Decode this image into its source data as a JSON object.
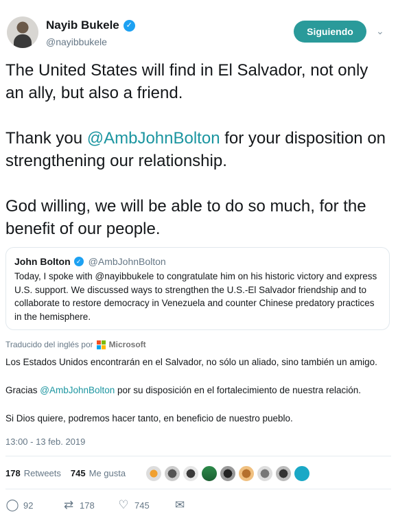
{
  "author": {
    "name": "Nayib Bukele",
    "handle": "@nayibbukele",
    "follow_label": "Siguiendo"
  },
  "tweet": {
    "paragraphs": [
      {
        "text": "The United States will find in El Salvador, not only an ally, but also a friend."
      },
      {
        "pre": "Thank you ",
        "mention": "@AmbJohnBolton",
        "post": " for your disposition on strengthening our relationship."
      },
      {
        "text": "God willing, we will be able to do so much, for the benefit of our people."
      }
    ]
  },
  "quote": {
    "name": "John Bolton",
    "handle": "@AmbJohnBolton",
    "text": "Today, I spoke with @nayibbukele to congratulate him on his historic victory and express U.S. support. We discussed ways to strengthen the U.S.-El Salvador friendship and to collaborate to restore democracy in Venezuela and counter Chinese predatory practices in the hemisphere."
  },
  "translation": {
    "label": "Traducido del inglés por",
    "provider": "Microsoft",
    "p1": "Los Estados Unidos encontrarán en el Salvador, no sólo un aliado, sino también un amigo.",
    "p2_pre": "Gracias ",
    "p2_mention": "@AmbJohnBolton",
    "p2_post": " por su disposición en el fortalecimiento de nuestra relación.",
    "p3": "Si Dios quiere, podremos hacer tanto, en beneficio de nuestro pueblo."
  },
  "timestamp": "13:00 - 13 feb. 2019",
  "stats": {
    "retweets_count": "178",
    "retweets_label": "Retweets",
    "likes_count": "745",
    "likes_label": "Me gusta"
  },
  "actions": {
    "replies": "92",
    "retweets": "178",
    "likes": "745"
  },
  "colors": {
    "accent": "#1b95a0",
    "follow_button": "#2a9a9a",
    "verified": "#1da1f2"
  }
}
